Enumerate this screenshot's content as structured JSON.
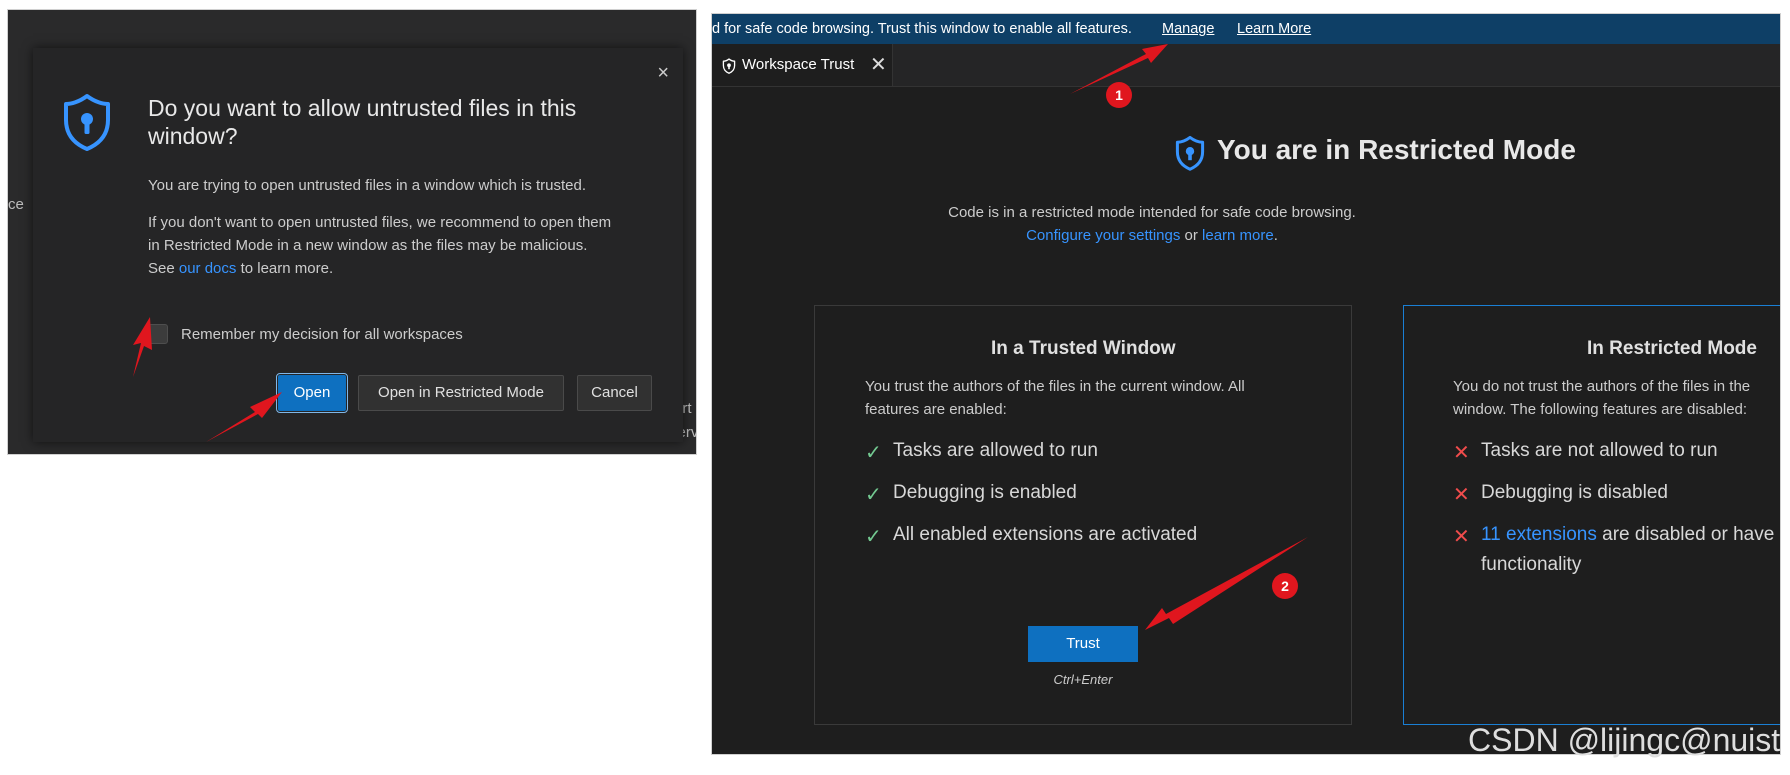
{
  "left": {
    "background_fragments": {
      "f1": "ce",
      "f2": "ort",
      "f3": "serv"
    },
    "dialog": {
      "close_glyph": "×",
      "title": "Do you want to allow untrusted files in this window?",
      "para1": "You are trying to open untrusted files in a window which is trusted.",
      "para2_start": "If you don't want to open untrusted files, we recommend to open them in Restricted Mode in a new window as the files may be malicious. See ",
      "para2_link": "our docs",
      "para2_end": " to learn more.",
      "remember_label": "Remember my decision for all workspaces",
      "remember_checked": false,
      "buttons": {
        "open": "Open",
        "restricted": "Open in Restricted Mode",
        "cancel": "Cancel"
      }
    }
  },
  "right": {
    "banner": {
      "text": "d for safe code browsing. Trust this window to enable all features.",
      "manage": "Manage",
      "learn_more": "Learn More"
    },
    "tab": {
      "label": "Workspace Trust",
      "close_glyph": "✕"
    },
    "title": "You are in Restricted Mode",
    "subtitle": "Code is in a restricted mode intended for safe code browsing.",
    "configure_link": "Configure your settings",
    "or_text": " or ",
    "learn_more_link": "learn more",
    "period": ".",
    "trusted": {
      "title": "In a Trusted Window",
      "desc_line1": "You trust the authors of the files in the current window. All",
      "desc_line2": "features are enabled:",
      "features": [
        "Tasks are allowed to run",
        "Debugging is enabled",
        "All enabled extensions are activated"
      ],
      "check_glyph": "✓",
      "trust_button": "Trust",
      "trust_hint": "Ctrl+Enter"
    },
    "restricted": {
      "title": "In Restricted Mode",
      "desc_line1": "You do not trust the authors of the files in the",
      "desc_line2": "window. The following features are disabled:",
      "features": [
        "Tasks are not allowed to run",
        "Debugging is disabled"
      ],
      "extensions_link": "11 extensions",
      "extensions_rest": " are disabled or have",
      "extensions_line2": "functionality",
      "cross_glyph": "✕"
    }
  },
  "annotations": {
    "badge1": "1",
    "badge2": "2"
  },
  "watermark": "CSDN @lijingc@nuist",
  "colors": {
    "accent": "#0e70c0",
    "link": "#3794ff",
    "arrow": "#e0161e",
    "check": "#73c991",
    "cross": "#f14c4c"
  },
  "icons": {
    "shield": "shield-keyhole-icon",
    "close": "close-icon",
    "check": "check-icon",
    "cross": "cross-icon"
  }
}
